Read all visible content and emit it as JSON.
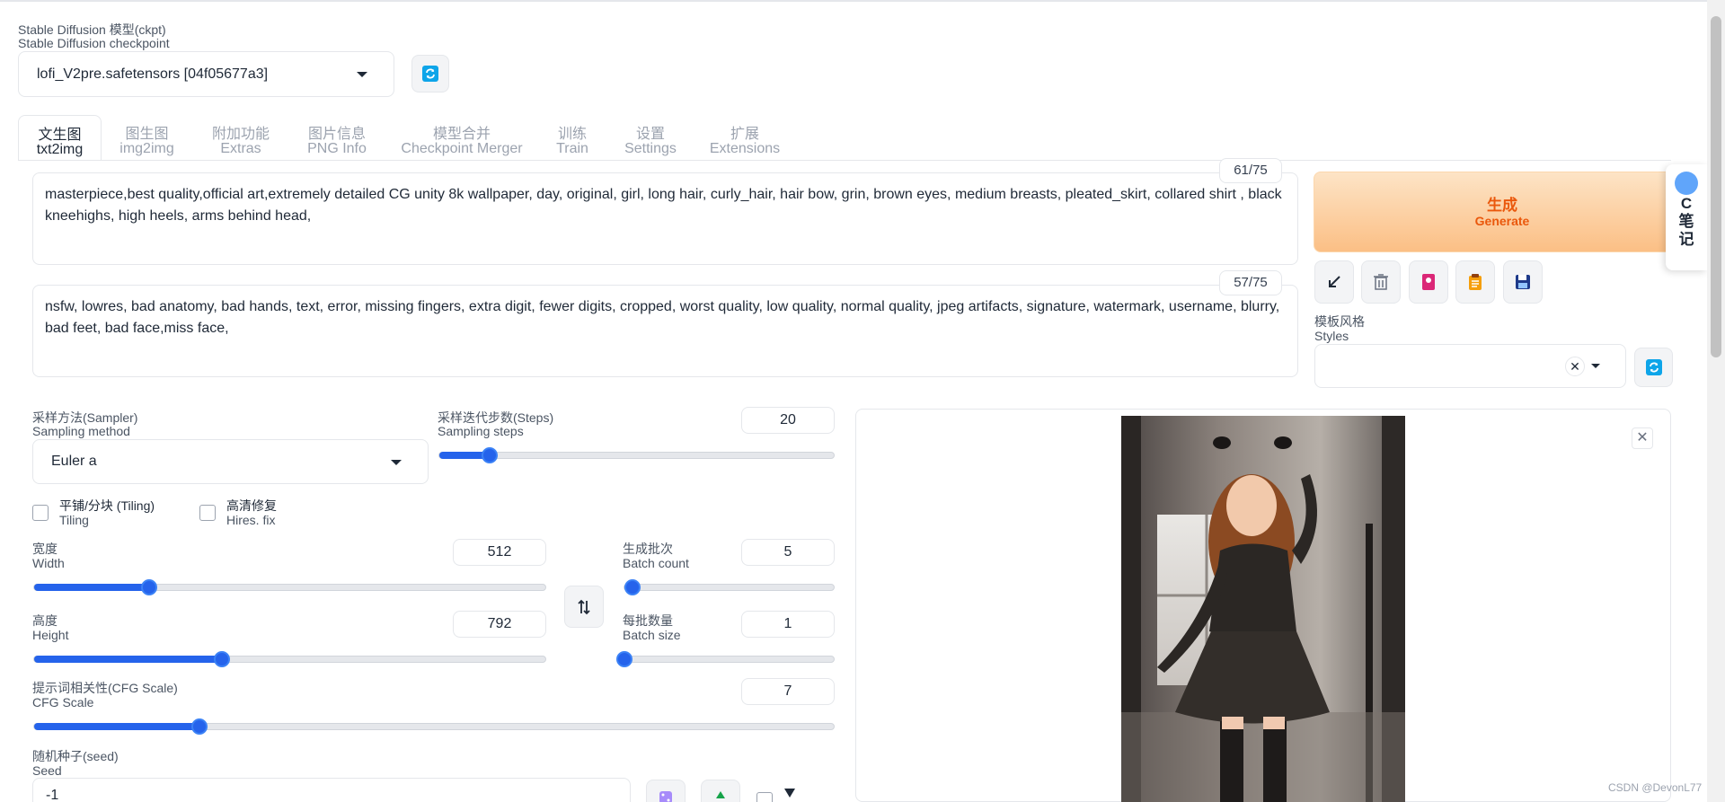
{
  "checkpoint": {
    "label_cn": "Stable Diffusion 模型(ckpt)",
    "label_en": "Stable Diffusion checkpoint",
    "value": "lofi_V2pre.safetensors [04f05677a3]"
  },
  "tabs": [
    {
      "cn": "文生图",
      "en": "txt2img"
    },
    {
      "cn": "图生图",
      "en": "img2img"
    },
    {
      "cn": "附加功能",
      "en": "Extras"
    },
    {
      "cn": "图片信息",
      "en": "PNG Info"
    },
    {
      "cn": "模型合并",
      "en": "Checkpoint Merger"
    },
    {
      "cn": "训练",
      "en": "Train"
    },
    {
      "cn": "设置",
      "en": "Settings"
    },
    {
      "cn": "扩展",
      "en": "Extensions"
    }
  ],
  "prompt": {
    "counter": "61/75",
    "text": "masterpiece,best quality,official art,extremely detailed CG unity 8k wallpaper, day, original, girl, long hair, curly_hair, hair bow, grin, brown eyes, medium breasts, pleated_skirt, collared shirt , black kneehighs, high heels, arms behind head,"
  },
  "negative_prompt": {
    "counter": "57/75",
    "text": "nsfw, lowres, bad anatomy, bad hands, text, error, missing fingers, extra digit, fewer digits, cropped, worst quality, low quality, normal quality, jpeg artifacts, signature, watermark, username, blurry, bad feet, bad face,miss face,"
  },
  "generate": {
    "cn": "生成",
    "en": "Generate"
  },
  "styles": {
    "label_cn": "模板风格",
    "label_en": "Styles",
    "clear": "✕"
  },
  "sampler": {
    "label_cn": "采样方法(Sampler)",
    "label_en": "Sampling method",
    "value": "Euler a"
  },
  "steps": {
    "label_cn": "采样迭代步数(Steps)",
    "label_en": "Sampling steps",
    "value": "20",
    "min": 1,
    "max": 150
  },
  "tiling": {
    "label_cn": "平铺/分块 (Tiling)",
    "label_en": "Tiling"
  },
  "hires": {
    "label_cn": "高清修复",
    "label_en": "Hires. fix"
  },
  "width": {
    "label_cn": "宽度",
    "label_en": "Width",
    "value": "512",
    "min": 64,
    "max": 2048
  },
  "height": {
    "label_cn": "高度",
    "label_en": "Height",
    "value": "792",
    "min": 64,
    "max": 2048
  },
  "batch_count": {
    "label_cn": "生成批次",
    "label_en": "Batch count",
    "value": "5",
    "min": 1,
    "max": 100
  },
  "batch_size": {
    "label_cn": "每批数量",
    "label_en": "Batch size",
    "value": "1",
    "min": 1,
    "max": 8
  },
  "cfg": {
    "label_cn": "提示词相关性(CFG Scale)",
    "label_en": "CFG Scale",
    "value": "7",
    "min": 1,
    "max": 30
  },
  "seed": {
    "label_cn": "随机种子(seed)",
    "label_en": "Seed",
    "value": "-1"
  },
  "notes": {
    "c": "C",
    "text": "笔记"
  },
  "footer": "CSDN @DevonL77",
  "colors": {
    "accent": "#2563eb",
    "generate": "#ea580c",
    "refresh": "#0ea5e9"
  }
}
